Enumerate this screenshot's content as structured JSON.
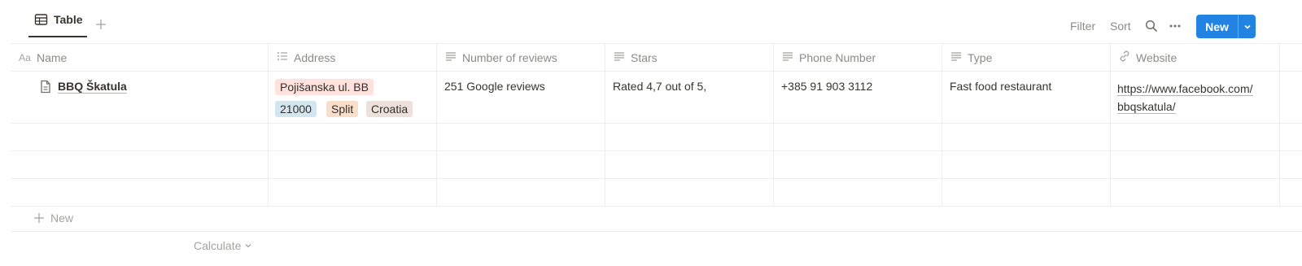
{
  "toolbar": {
    "view_tab_label": "Table",
    "filter_label": "Filter",
    "sort_label": "Sort",
    "new_button_label": "New",
    "icons": [
      "table-icon",
      "plus-icon",
      "search-icon",
      "more-icon",
      "chevron-down-icon"
    ],
    "accent_color": "#2383e2"
  },
  "table": {
    "columns": [
      {
        "label": "Name",
        "icon": "aa-title-icon"
      },
      {
        "label": "Address",
        "icon": "list-icon"
      },
      {
        "label": "Number of reviews",
        "icon": "text-icon"
      },
      {
        "label": "Stars",
        "icon": "text-icon"
      },
      {
        "label": "Phone Number",
        "icon": "text-icon"
      },
      {
        "label": "Type",
        "icon": "text-icon"
      },
      {
        "label": "Website",
        "icon": "link-icon"
      }
    ],
    "aa_glyph": "Aa",
    "rows": [
      {
        "name": "BBQ Škatula",
        "address_tags": [
          {
            "label": "Pojišanska ul. BB",
            "color": "#ffe2dd"
          },
          {
            "label": "21000",
            "color": "#d3e5ef"
          },
          {
            "label": "Split",
            "color": "#fadec9"
          },
          {
            "label": "Croatia",
            "color": "#eee0da"
          }
        ],
        "reviews": "251 Google reviews",
        "stars": "Rated 4,7 out of 5,",
        "phone": "+385 91 903 3112",
        "type": "Fast food restaurant",
        "website_line1": "https://www.facebook.com/",
        "website_line2": "bbqskatula/"
      }
    ]
  },
  "footer": {
    "new_row_label": "New",
    "calculate_label": "Calculate"
  }
}
